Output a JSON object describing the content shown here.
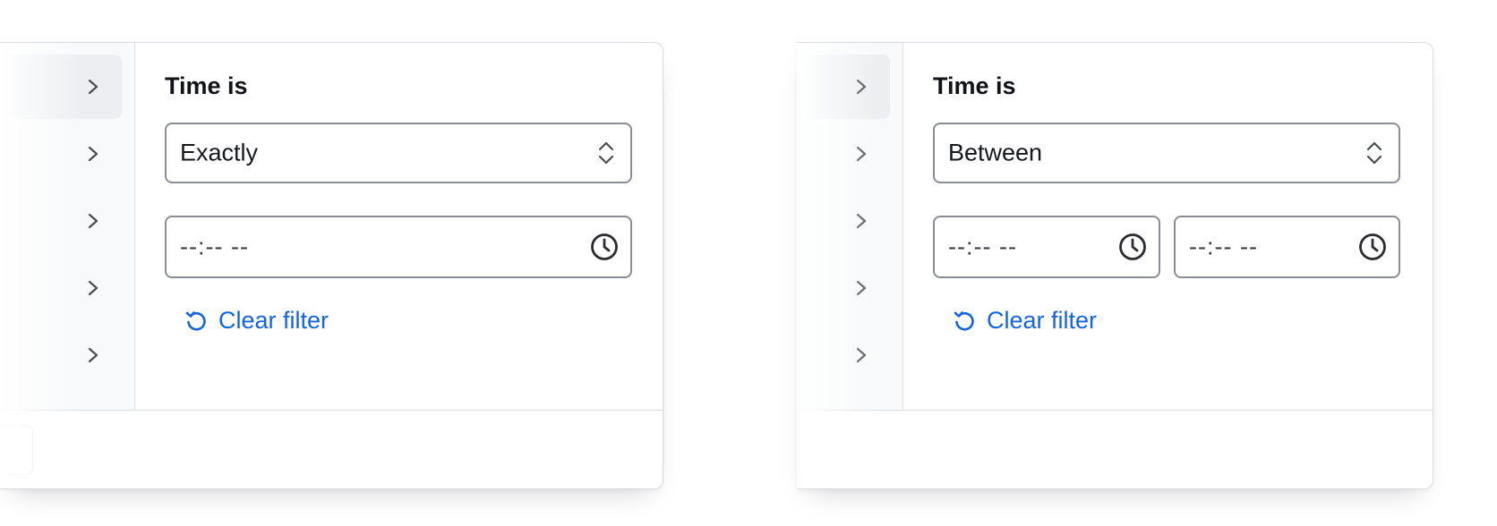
{
  "panels": [
    {
      "title": "Time is",
      "operator": "Exactly",
      "time_inputs": [
        "--:-- --"
      ],
      "clear_label": "Clear filter"
    },
    {
      "title": "Time is",
      "operator": "Between",
      "time_inputs": [
        "--:-- --",
        "--:-- --"
      ],
      "clear_label": "Clear filter"
    }
  ],
  "colors": {
    "accent": "#1565e0",
    "border": "#8a8d98",
    "text": "#16181d"
  },
  "icons": {
    "nav_chevron": "chevron-right-icon",
    "select_arrows": "chevron-up-down-icon",
    "time": "clock-icon",
    "reset": "reset-icon"
  }
}
